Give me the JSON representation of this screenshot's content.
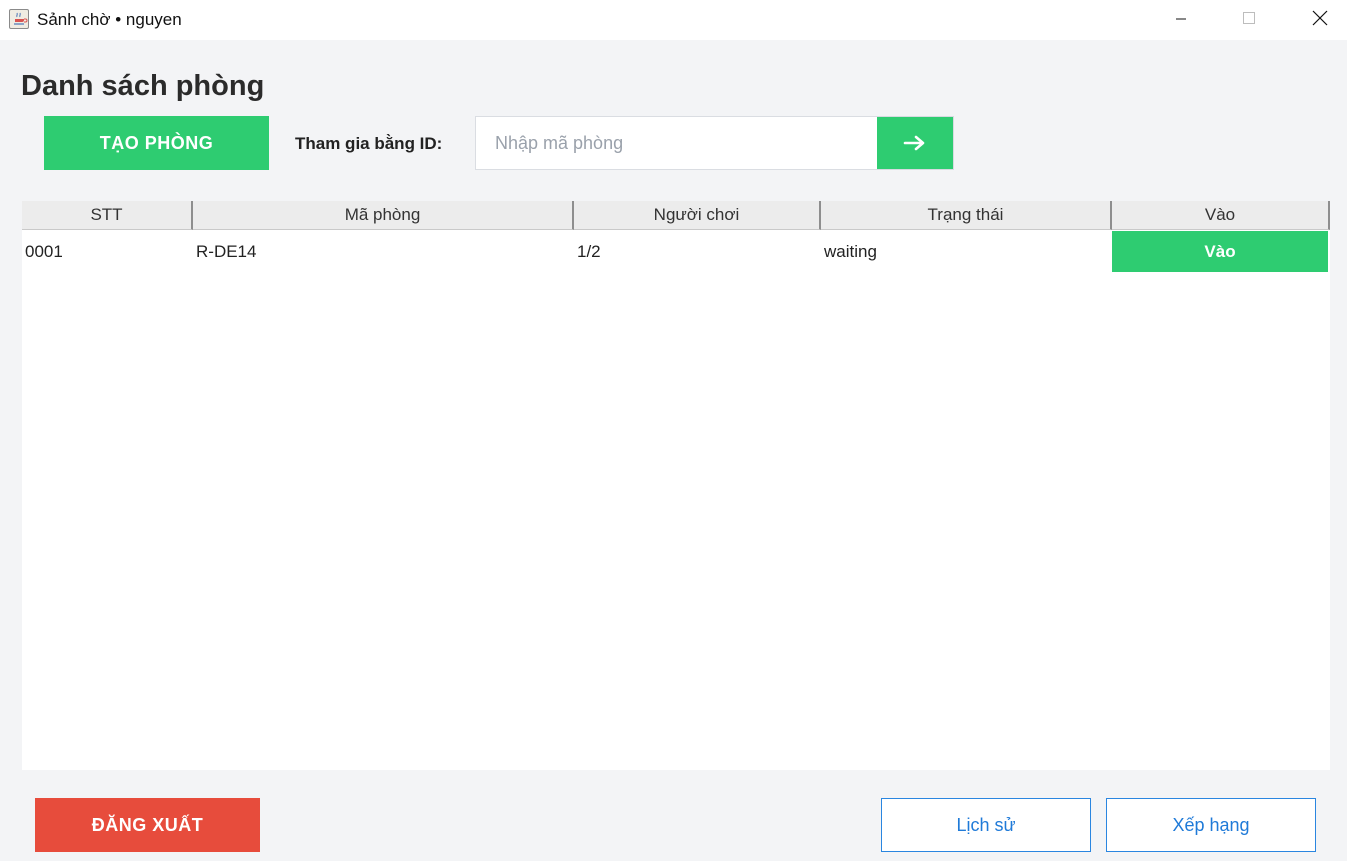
{
  "window": {
    "title": "Sảnh chờ • nguyen",
    "app_icon": "java-coffee-icon",
    "controls": [
      "minimize-icon",
      "maximize-icon",
      "close-icon"
    ]
  },
  "lobby": {
    "title": "Danh sách phòng",
    "create_room_label": "TẠO PHÒNG",
    "join_label": "Tham gia bằng ID:",
    "room_id_placeholder": "Nhập mã phòng",
    "room_id_value": "",
    "join_go_icon": "arrow-right-icon"
  },
  "table": {
    "columns": [
      "STT",
      "Mã phòng",
      "Người chơi",
      "Trạng thái",
      "Vào"
    ],
    "rows": [
      {
        "stt": "0001",
        "room_code": "R-DE14",
        "players": "1/2",
        "status": "waiting",
        "action_label": "Vào"
      }
    ]
  },
  "footer": {
    "logout_label": "ĐĂNG XUẤT",
    "history_label": "Lịch sử",
    "ranking_label": "Xếp hạng"
  },
  "colors": {
    "primary_green": "#2ecc71",
    "danger_red": "#e74c3c",
    "link_blue": "#1f7ad8",
    "background": "#f3f4f6"
  }
}
